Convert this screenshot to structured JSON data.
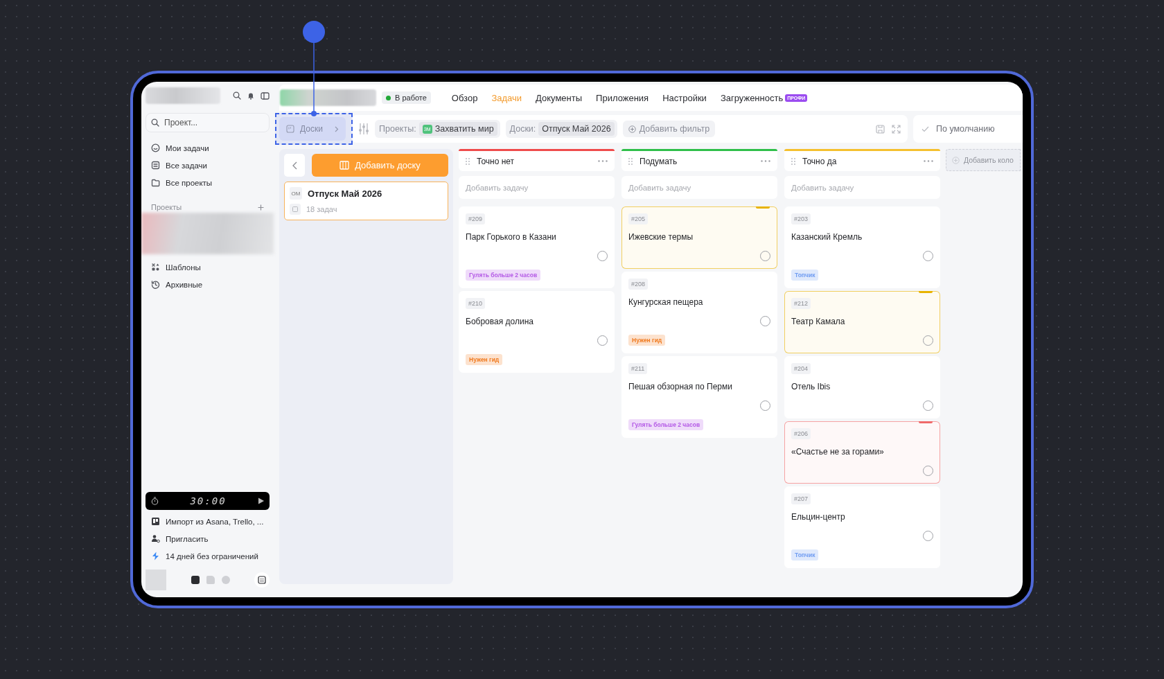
{
  "sidebar": {
    "search": {
      "placeholder": "Проект..."
    },
    "nav": [
      {
        "label": "Мои задачи"
      },
      {
        "label": "Все задачи"
      },
      {
        "label": "Все проекты"
      }
    ],
    "projects_heading": "Проекты",
    "more_nav": [
      {
        "label": "Шаблоны"
      },
      {
        "label": "Архивные"
      }
    ],
    "timer": {
      "time": "30:00"
    },
    "footer_links": [
      {
        "label": "Импорт из Asana, Trello, ..."
      },
      {
        "label": "Пригласить"
      },
      {
        "label": "14 дней без ограничений"
      }
    ],
    "view_switch": [
      {
        "selected": true
      },
      {
        "selected": false
      },
      {
        "selected": false
      }
    ]
  },
  "header": {
    "status": "В работе",
    "tabs": [
      {
        "label": "Обзор",
        "selected": false
      },
      {
        "label": "Задачи",
        "selected": true
      },
      {
        "label": "Документы",
        "selected": false
      },
      {
        "label": "Приложения",
        "selected": false
      },
      {
        "label": "Настройки",
        "selected": false
      },
      {
        "label": "Загруженность",
        "selected": false,
        "badge": "ПРОФИ"
      }
    ]
  },
  "filters": {
    "crumb": "Доски",
    "projects_label": "Проекты:",
    "project_initials": "ЗМ",
    "project_name": "Захватить мир",
    "boards_label": "Доски:",
    "board_value": "Отпуск Май 2026",
    "add_filter": "Добавить фильтр",
    "view": "По умолчанию"
  },
  "boards_panel": {
    "add_button": "Добавить доску",
    "boards": [
      {
        "initials": "ОМ",
        "name": "Отпуск Май 2026",
        "count": "18 задач",
        "selected": true
      }
    ]
  },
  "columns": [
    {
      "title": "Точно нет",
      "color": "#ef4b4b",
      "add_placeholder": "Добавить задачу",
      "cards": [
        {
          "id": "#209",
          "title": "Парк Горького в Казани",
          "checked": false,
          "tag": {
            "label": "Гулять больше 2 часов",
            "color": "#b45ae6"
          }
        },
        {
          "id": "#210",
          "title": "Бобровая долина",
          "checked": false,
          "tag": {
            "label": "Нужен гид",
            "color": "#f07a1f"
          }
        }
      ]
    },
    {
      "title": "Подумать",
      "color": "#2fbf4a",
      "add_placeholder": "Добавить задачу",
      "cards": [
        {
          "id": "#205",
          "title": "Ижевские термы",
          "checked": false,
          "color": "#e8b300"
        },
        {
          "id": "#208",
          "title": "Кунгурская пещера",
          "checked": false,
          "tag": {
            "label": "Нужен гид",
            "color": "#f07a1f"
          }
        },
        {
          "id": "#211",
          "title": "Пешая обзорная по Перми",
          "checked": false,
          "tag": {
            "label": "Гулять больше 2 часов",
            "color": "#b45ae6"
          }
        }
      ]
    },
    {
      "title": "Точно да",
      "color": "#f5c02e",
      "add_placeholder": "Добавить задачу",
      "cards": [
        {
          "id": "#203",
          "title": "Казанский Кремль",
          "checked": false,
          "tag": {
            "label": "Топчик",
            "color": "#6f9cf2"
          }
        },
        {
          "id": "#212",
          "title": "Театр Камала",
          "checked": false,
          "color": "#e8b300"
        },
        {
          "id": "#204",
          "title": "Отель Ibis",
          "checked": false
        },
        {
          "id": "#206",
          "title": "«Счастье не за горами»",
          "checked": false,
          "color": "#f06a6a"
        },
        {
          "id": "#207",
          "title": "Ельцин-центр",
          "checked": false,
          "tag": {
            "label": "Топчик",
            "color": "#6f9cf2"
          }
        }
      ]
    }
  ],
  "add_column": "Добавить коло"
}
